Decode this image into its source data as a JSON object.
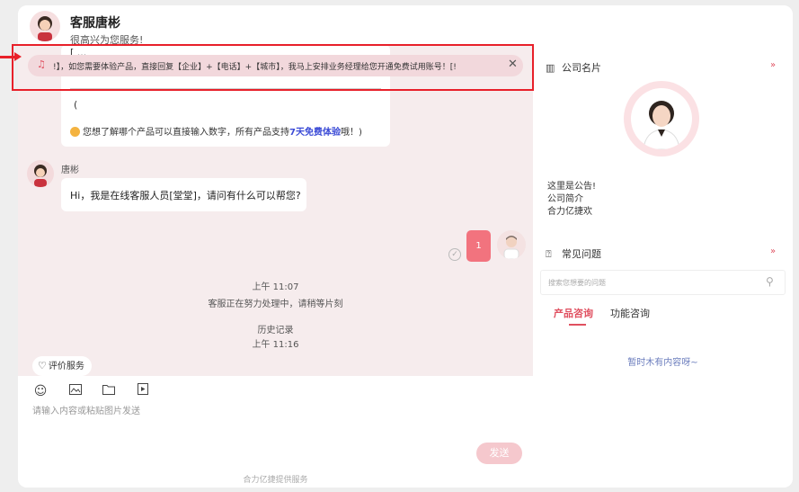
{
  "header": {
    "title": "客服唐彬",
    "subtitle": "很高兴为您服务!"
  },
  "notice": {
    "text": "!】，如您需要体验产品，直接回复【企业】+【电话】+【城市】，我马上安排业务经理给您开通免费试用账号！[!"
  },
  "messages": {
    "card_cut": "[ ...",
    "card_paren": "(",
    "card_line_prefix": "您想了解哪个产品可以直接输入数字，所有产品支持",
    "card_line_highlight": "7天免费体验",
    "card_line_suffix": "哦！)",
    "agent_name": "唐彬",
    "agent_greeting": "Hi，我是在线客服人员[堂堂]，请问有什么可以帮您?",
    "my_message": "1",
    "sys_time1": "上午 11:07",
    "sys_status": "客服正在努力处理中，请稍等片刻",
    "sys_history": "历史记录",
    "sys_time2": "上午 11:16",
    "rate_label": "评价服务"
  },
  "input": {
    "placeholder": "请输入内容或粘贴图片发送",
    "send_label": "发送",
    "footer": "合力亿捷提供服务"
  },
  "sidebar": {
    "company_card_title": "公司名片",
    "notice_lines": [
      "这里是公告!",
      "公司简介",
      "合力亿捷欢"
    ],
    "faq_title": "常见问题",
    "search_placeholder": "搜索您想要的问题",
    "tabs": [
      "产品咨询",
      "功能咨询"
    ],
    "empty_text": "暂时木有内容呀~"
  },
  "colors": {
    "accent": "#e05060",
    "chat_bg": "#f6eced",
    "highlight_box": "#e8202a"
  },
  "icons": [
    "bell-icon",
    "close-icon",
    "emoji-icon",
    "image-icon",
    "folder-icon",
    "video-icon",
    "heart-icon",
    "building-icon",
    "question-icon",
    "search-icon",
    "chevron-down-icon",
    "check-icon"
  ]
}
